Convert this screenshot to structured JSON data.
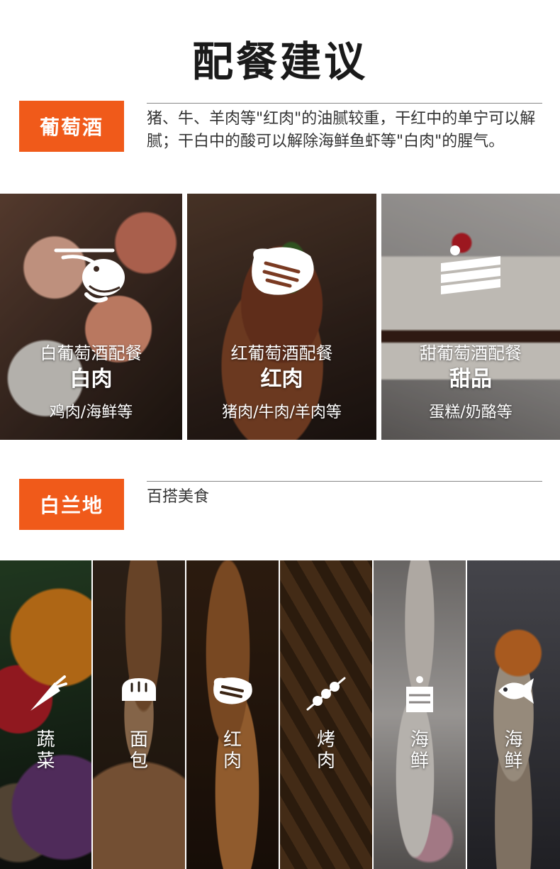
{
  "page_title": "配餐建议",
  "wine": {
    "label": "葡萄酒",
    "description": "猪、牛、羊肉等\"红肉\"的油腻较重，干红中的单宁可以解腻；干白中的酸可以解除海鲜鱼虾等\"白肉\"的腥气。",
    "panels": [
      {
        "line1": "白葡萄酒配餐",
        "line2": "白肉",
        "line3": "鸡肉/海鲜等",
        "icon": "shrimp-icon"
      },
      {
        "line1": "红葡萄酒配餐",
        "line2": "红肉",
        "line3": "猪肉/牛肉/羊肉等",
        "icon": "steak-icon"
      },
      {
        "line1": "甜葡萄酒配餐",
        "line2": "甜品",
        "line3": "蛋糕/奶酪等",
        "icon": "cake-icon"
      }
    ]
  },
  "brandy": {
    "label": "白兰地",
    "description": "百搭美食",
    "panels": [
      {
        "c1": "蔬",
        "c2": "菜",
        "icon": "carrot-icon"
      },
      {
        "c1": "面",
        "c2": "包",
        "icon": "bread-icon"
      },
      {
        "c1": "红",
        "c2": "肉",
        "icon": "steak-icon"
      },
      {
        "c1": "烤",
        "c2": "肉",
        "icon": "skewer-icon"
      },
      {
        "c1": "海",
        "c2": "鲜",
        "icon": "cake-icon"
      },
      {
        "c1": "海",
        "c2": "鲜",
        "icon": "fish-icon"
      }
    ]
  },
  "colors": {
    "accent": "#f05a1a"
  }
}
